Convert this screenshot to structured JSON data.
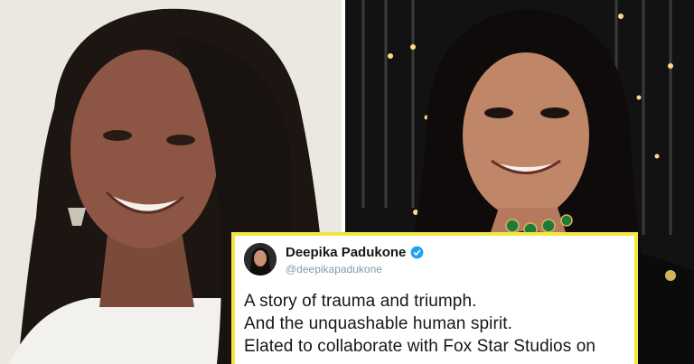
{
  "tweet": {
    "display_name": "Deepika Padukone",
    "handle": "@deepikapadukone",
    "verified": true,
    "lines": [
      "A story of trauma and triumph.",
      "And the unquashable human spirit.",
      "Elated to collaborate with Fox Star Studios on"
    ]
  },
  "colors": {
    "card_border": "#f2e640",
    "verified_badge": "#1da1f2",
    "handle_text": "#8899a6"
  }
}
